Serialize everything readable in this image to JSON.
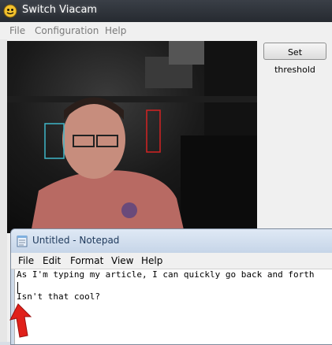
{
  "app": {
    "title": "Switch Viacam",
    "menu": [
      "File",
      "Configuration",
      "Help"
    ],
    "set_threshold_label": "Set threshold"
  },
  "notepad": {
    "title": "Untitled - Notepad",
    "menu": [
      "File",
      "Edit",
      "Format",
      "View",
      "Help"
    ],
    "lines": [
      "As I'm typing my article, I can quickly go back and forth",
      "",
      "Isn't that cool?"
    ]
  },
  "colors": {
    "left_box": "#3fb6c8",
    "right_box": "#d42323",
    "arrow": "#e0201a"
  }
}
